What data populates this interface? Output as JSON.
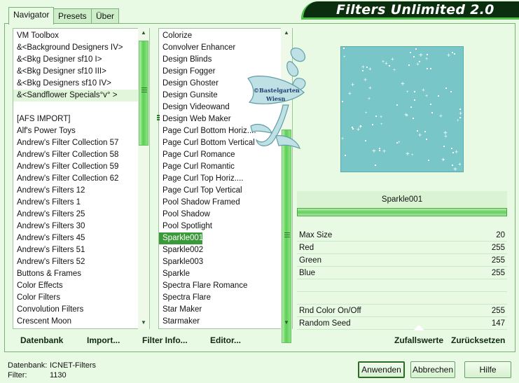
{
  "app_title": "Filters Unlimited 2.0",
  "tabs": [
    "Navigator",
    "Presets",
    "Über"
  ],
  "categories": [
    "VM Toolbox",
    "&<Background Designers IV>",
    "&<Bkg Designer sf10 I>",
    "&<Bkg Designer sf10 III>",
    "&<Bkg Designers sf10 IV>",
    "&<Sandflower Specials°v° >",
    "",
    "[AFS IMPORT]",
    "Alf's Power Toys",
    "Andrew's Filter Collection 57",
    "Andrew's Filter Collection 58",
    "Andrew's Filter Collection 59",
    "Andrew's Filter Collection 62",
    "Andrew's Filters 12",
    "Andrew's Filters 1",
    "Andrew's Filters 25",
    "Andrew's Filters 30",
    "Andrew's Filters 45",
    "Andrew's Filters 51",
    "Andrew's Filters 52",
    "Buttons & Frames",
    "Color Effects",
    "Color Filters",
    "Convolution Filters",
    "Crescent Moon"
  ],
  "filters": [
    "Colorize",
    "Convolver Enhancer",
    "Design Blinds",
    "Design Fogger",
    "Design Ghoster",
    "Design Gunsite",
    "Design Videowand",
    "Design Web Maker",
    "Page Curl Bottom Horiz....",
    "Page Curl Bottom Vertical",
    "Page Curl Romance",
    "Page Curl Romantic",
    "Page Curl Top Horiz....",
    "Page Curl Top Vertical",
    "Pool Shadow Framed",
    "Pool Shadow",
    "Pool Spotlight",
    "Sparkle001",
    "Sparkle002",
    "Sparkle003",
    "Sparkle",
    "Spectra Flare Romance",
    "Spectra Flare",
    "Star Maker",
    "Starmaker"
  ],
  "actions": {
    "database": "Datenbank",
    "import": "Import...",
    "filter_info": "Filter Info...",
    "editor": "Editor...",
    "randomize": "Zufallswerte",
    "reset": "Zurücksetzen"
  },
  "selected_filter": "Sparkle001",
  "params": [
    {
      "label": "Max Size",
      "value": "20"
    },
    {
      "label": "Red",
      "value": "255"
    },
    {
      "label": "Green",
      "value": "255"
    },
    {
      "label": "Blue",
      "value": "255"
    },
    {
      "label": "Rnd Color On/Off",
      "value": "255"
    },
    {
      "label": "Random Seed",
      "value": "147"
    }
  ],
  "info": {
    "db_label": "Datenbank:",
    "db_value": "ICNET-Filters",
    "filter_label": "Filter:",
    "filter_value": "1130"
  },
  "buttons": {
    "apply": "Anwenden",
    "cancel": "Abbrechen",
    "help": "Hilfe"
  },
  "watermark": "©Bastelgarten Wiesn",
  "colors": {
    "accent": "#3a9a3a",
    "banner": "#0b2e0f",
    "preview": "#78c6c8"
  }
}
